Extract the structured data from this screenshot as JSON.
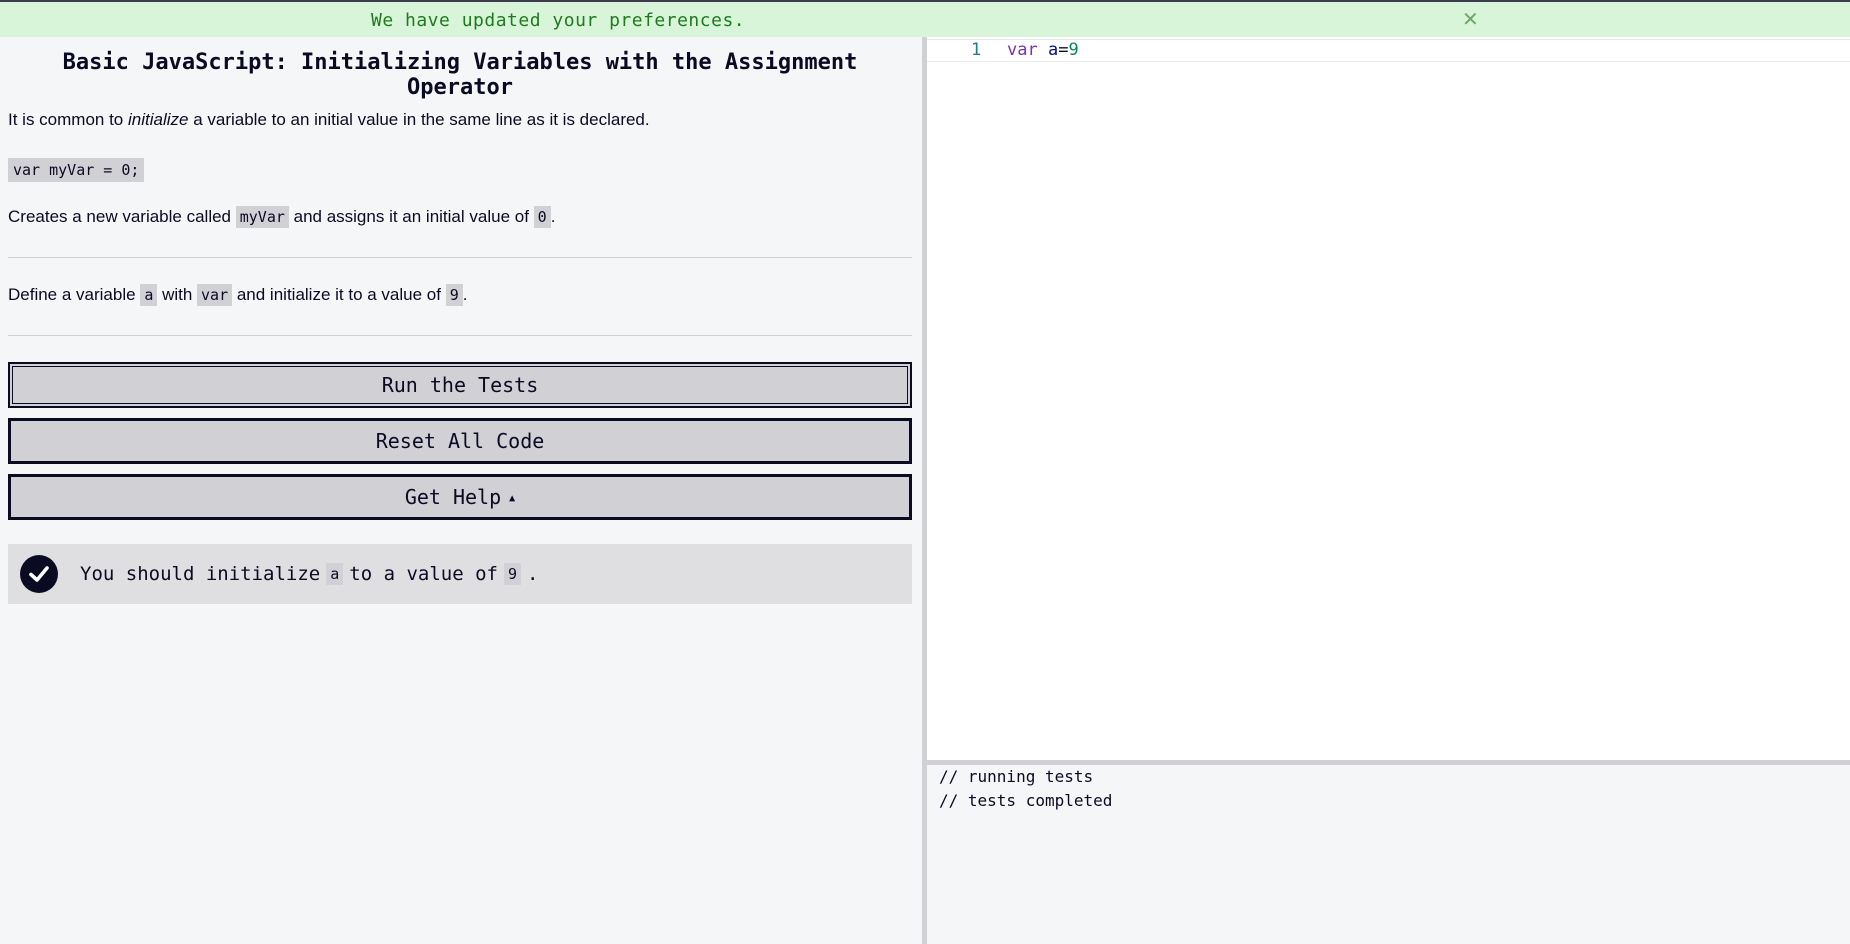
{
  "flash": {
    "message": "We have updated your preferences.",
    "close_glyph": "✕"
  },
  "challenge": {
    "title": "Basic JavaScript: Initializing Variables with the Assignment Operator",
    "intro_before": "It is common to ",
    "intro_em": "initialize",
    "intro_after": " a variable to an initial value in the same line as it is declared.",
    "example_code": "var myVar = 0;",
    "explain_before": "Creates a new variable called ",
    "explain_code1": "myVar",
    "explain_mid": " and assigns it an initial value of ",
    "explain_code2": "0",
    "explain_after": ".",
    "task_before": "Define a variable ",
    "task_code1": "a",
    "task_mid1": " with ",
    "task_code2": "var",
    "task_mid2": " and initialize it to a value of ",
    "task_code3": "9",
    "task_after": "."
  },
  "buttons": {
    "run": "Run the Tests",
    "reset": "Reset All Code",
    "help": "Get Help",
    "help_caret": "▲"
  },
  "tests": [
    {
      "passed": true,
      "text_before": "You should initialize",
      "code1": "a",
      "text_mid": "to a value of",
      "code2": "9",
      "text_after": "."
    }
  ],
  "editor": {
    "line_number": "1",
    "tokens": {
      "kw": "var",
      "ident": "a",
      "op": "=",
      "num": "9"
    }
  },
  "console": {
    "lines": [
      "// running tests",
      "// tests completed"
    ]
  },
  "colors": {
    "flash_bg": "#d9f5d9",
    "flash_text": "#1f7a1f",
    "button_bg": "#d0d0d5",
    "primary_dark": "#0a0a23"
  }
}
